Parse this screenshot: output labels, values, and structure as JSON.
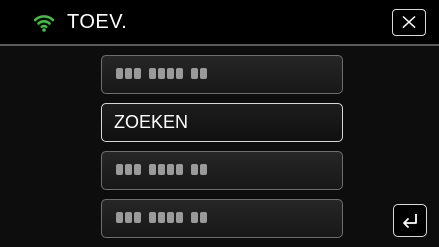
{
  "header": {
    "wifi_icon": "wifi-icon",
    "title": "TOEV.",
    "close_icon": "close-icon"
  },
  "list": {
    "items": [
      {
        "label": "",
        "masked": true
      },
      {
        "label": "ZOEKEN",
        "masked": false,
        "selected": true
      },
      {
        "label": "",
        "masked": true
      },
      {
        "label": "",
        "masked": true
      }
    ]
  },
  "footer": {
    "back_icon": "return-icon"
  },
  "colors": {
    "background": "#000000",
    "wifi": "#3fbf3f",
    "text": "#ffffff"
  }
}
